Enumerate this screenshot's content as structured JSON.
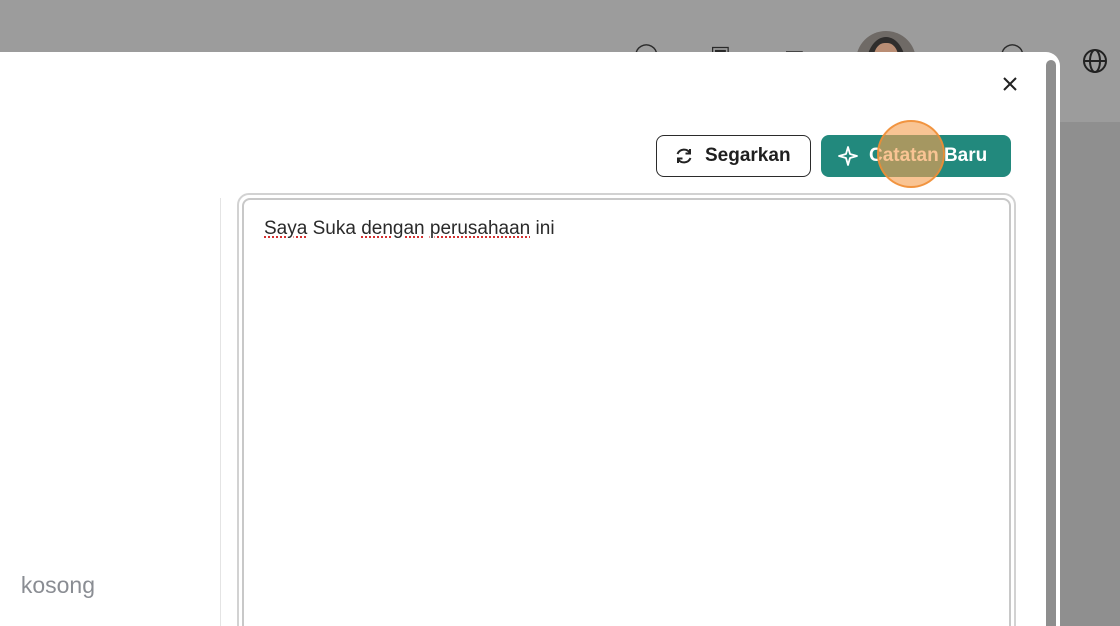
{
  "modal": {
    "close_icon": "close-icon",
    "refresh_button": {
      "label": "Segarkan",
      "icon": "refresh-icon"
    },
    "new_note_button": {
      "label": "Catatan Baru",
      "icon": "sparkle-icon",
      "color": "#22897d"
    },
    "empty_state_text": "kosong",
    "note_editor": {
      "words": [
        "Saya",
        "Suka",
        "dengan",
        "perusahaan",
        "ini"
      ]
    }
  },
  "background_header": {
    "icons": [
      "help-icon",
      "calendar-icon",
      "mail-icon",
      "avatar",
      "question-icon",
      "globe-icon"
    ]
  }
}
